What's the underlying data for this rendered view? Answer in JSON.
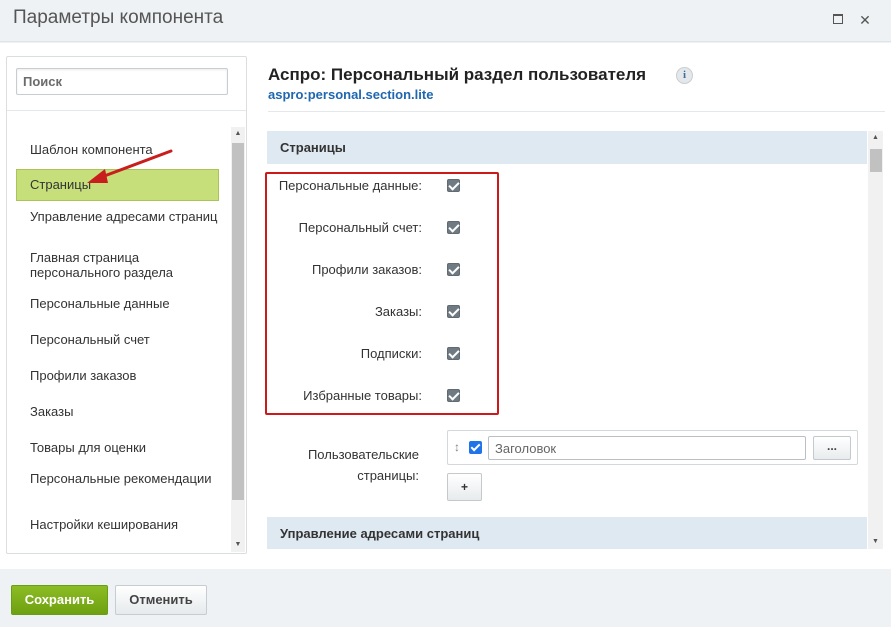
{
  "window": {
    "title": "Параметры компонента",
    "maximize_icon": "maximize-icon",
    "close_icon": "close-icon"
  },
  "sidebar": {
    "search_placeholder": "Поиск",
    "active_index": 1,
    "items": [
      {
        "label": "Шаблон компонента"
      },
      {
        "label": "Страницы"
      },
      {
        "label": "Управление адресами страниц"
      },
      {
        "label": "Главная страница персонального раздела"
      },
      {
        "label": "Персональные данные"
      },
      {
        "label": "Персональный счет"
      },
      {
        "label": "Профили заказов"
      },
      {
        "label": "Заказы"
      },
      {
        "label": "Товары для оценки"
      },
      {
        "label": "Персональные рекомендации"
      },
      {
        "label": "Настройки кеширования"
      }
    ]
  },
  "component": {
    "title": "Аспро: Персональный раздел пользователя",
    "code": "aspro:personal.section.lite",
    "info_icon": "i"
  },
  "pages_section": {
    "header": "Страницы",
    "options": [
      {
        "label": "Персональные данные:",
        "checked": true
      },
      {
        "label": "Персональный счет:",
        "checked": true
      },
      {
        "label": "Профили заказов:",
        "checked": true
      },
      {
        "label": "Заказы:",
        "checked": true
      },
      {
        "label": "Подписки:",
        "checked": true
      },
      {
        "label": "Избранные товары:",
        "checked": true
      }
    ],
    "custom_pages": {
      "label_line1": "Пользовательские",
      "label_line2": "страницы:",
      "row_checked": true,
      "input_placeholder": "Заголовок",
      "browse_label": "...",
      "add_label": "+"
    }
  },
  "url_section": {
    "header": "Управление адресами страниц"
  },
  "footer": {
    "save_label": "Сохранить",
    "cancel_label": "Отменить"
  },
  "colors": {
    "active_item": "#c6df7a",
    "highlight": "#cc1a1a",
    "save_button": "#7aad18",
    "link": "#2067b0"
  }
}
